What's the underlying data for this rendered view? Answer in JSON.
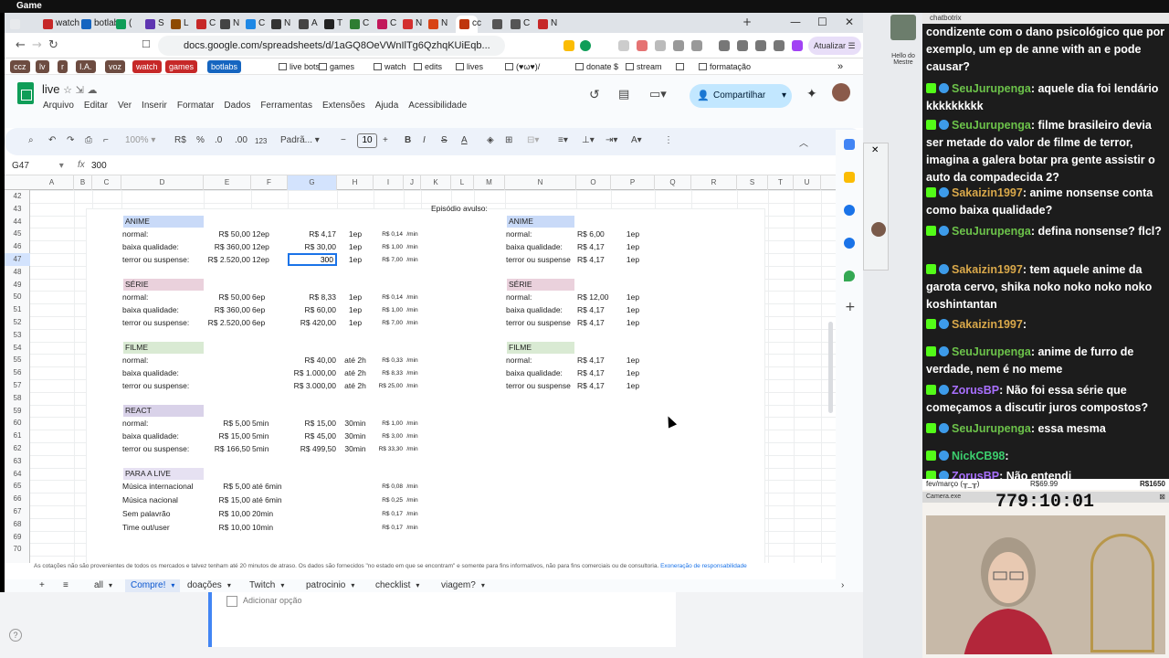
{
  "os": {
    "title": "Game"
  },
  "browser": {
    "tabs": [
      {
        "label": "",
        "color": "#e8eaed"
      },
      {
        "label": "watch",
        "color": "#c62828"
      },
      {
        "label": "botlabs",
        "color": "#1565c0"
      },
      {
        "label": "(",
        "color": "#0f9d58"
      },
      {
        "label": "S",
        "color": "#5e35b1"
      },
      {
        "label": "L",
        "color": "#8e4a00"
      },
      {
        "label": "C",
        "color": "#c62828"
      },
      {
        "label": "N",
        "color": "#444"
      },
      {
        "label": "C",
        "color": "#1e88e5"
      },
      {
        "label": "N",
        "color": "#333"
      },
      {
        "label": "A",
        "color": "#444"
      },
      {
        "label": "T",
        "color": "#222"
      },
      {
        "label": "C",
        "color": "#2e7d32"
      },
      {
        "label": "C",
        "color": "#c2185b"
      },
      {
        "label": "N",
        "color": "#d32f2f"
      },
      {
        "label": "N",
        "color": "#d84315"
      },
      {
        "label": "cc",
        "color": "#bf360c"
      },
      {
        "label": "",
        "color": "#555"
      },
      {
        "label": "C",
        "color": "#555"
      },
      {
        "label": "N",
        "color": "#c62828"
      }
    ],
    "url": "docs.google.com/spreadsheets/d/1aGQ8OeVWnIlTg6QzhqKUiEqb...",
    "update_label": "Atualizar",
    "bookmarks": [
      {
        "label": "ccz",
        "color": "#6d4c41"
      },
      {
        "label": "lv",
        "color": "#6d4c41"
      },
      {
        "label": "r",
        "color": "#6d4c41"
      },
      {
        "label": "I.A.",
        "color": "#6d4c41"
      },
      {
        "label": "voz",
        "color": "#6d4c41"
      },
      {
        "label": "watch",
        "color": "#c62828"
      },
      {
        "label": "games",
        "color": "#c62828"
      },
      {
        "label": "botlabs",
        "color": "#1565c0"
      },
      {
        "label": "live bots",
        "color": ""
      },
      {
        "label": "games",
        "color": ""
      },
      {
        "label": "watch",
        "color": ""
      },
      {
        "label": "edits",
        "color": ""
      },
      {
        "label": "lives",
        "color": ""
      },
      {
        "label": "(♥ω♥)/",
        "color": ""
      },
      {
        "label": "donate $",
        "color": ""
      },
      {
        "label": "stream",
        "color": ""
      },
      {
        "label": "",
        "color": ""
      },
      {
        "label": "formatação",
        "color": ""
      }
    ]
  },
  "sheets": {
    "title": "live",
    "menus": [
      "Arquivo",
      "Editar",
      "Ver",
      "Inserir",
      "Formatar",
      "Dados",
      "Ferramentas",
      "Extensões",
      "Ajuda",
      "Acessibilidade"
    ],
    "share_label": "Compartilhar",
    "toolbar": {
      "zoom": "100%",
      "currency": "R$",
      "percent": "%",
      "dec_less": ".0",
      "dec_more": ".00",
      "num_format": "123",
      "font": "Padrã...",
      "font_size": "10"
    },
    "cell_ref": "G47",
    "formula_value": "300",
    "columns": [
      "A",
      "B",
      "C",
      "D",
      "E",
      "F",
      "G",
      "H",
      "I",
      "J",
      "K",
      "L",
      "M",
      "N",
      "O",
      "P",
      "Q",
      "R",
      "S",
      "T",
      "U"
    ],
    "selected_col": "G",
    "rows": [
      "42",
      "43",
      "44",
      "45",
      "46",
      "47",
      "48",
      "49",
      "50",
      "51",
      "52",
      "53",
      "54",
      "55",
      "56",
      "57",
      "58",
      "59",
      "60",
      "61",
      "62",
      "63",
      "64",
      "65",
      "66",
      "67",
      "68",
      "69",
      "70"
    ],
    "selected_row": "47",
    "episodio_label": "Episódio avulso:",
    "left": {
      "anime": {
        "title": "ANIME",
        "rows": [
          {
            "label": "normal:",
            "e": "R$ 50,00",
            "f": "12ep",
            "g": "R$ 4,17",
            "h": "1ep",
            "i": "R$ 0,14",
            "j": "/min"
          },
          {
            "label": "baixa qualidade:",
            "e": "R$ 360,00",
            "f": "12ep",
            "g": "R$ 30,00",
            "h": "1ep",
            "i": "R$ 1,00",
            "j": "/min"
          },
          {
            "label": "terror ou suspense:",
            "e": "R$ 2.520,00",
            "f": "12ep",
            "g": "300",
            "h": "1ep",
            "i": "R$ 7,00",
            "j": "/min"
          }
        ]
      },
      "serie": {
        "title": "SÉRIE",
        "rows": [
          {
            "label": "normal:",
            "e": "R$ 50,00",
            "f": "6ep",
            "g": "R$ 8,33",
            "h": "1ep",
            "i": "R$ 0,14",
            "j": "/min"
          },
          {
            "label": "baixa qualidade:",
            "e": "R$ 360,00",
            "f": "6ep",
            "g": "R$ 60,00",
            "h": "1ep",
            "i": "R$ 1,00",
            "j": "/min"
          },
          {
            "label": "terror ou suspense:",
            "e": "R$ 2.520,00",
            "f": "6ep",
            "g": "R$ 420,00",
            "h": "1ep",
            "i": "R$ 7,00",
            "j": "/min"
          }
        ]
      },
      "filme": {
        "title": "FILME",
        "rows": [
          {
            "label": "normal:",
            "e": "",
            "f": "",
            "g": "R$ 40,00",
            "h": "até 2h",
            "i": "R$ 0,33",
            "j": "/min"
          },
          {
            "label": "baixa qualidade:",
            "e": "",
            "f": "",
            "g": "R$ 1.000,00",
            "h": "até 2h",
            "i": "R$ 8,33",
            "j": "/min"
          },
          {
            "label": "terror ou suspense:",
            "e": "",
            "f": "",
            "g": "R$ 3.000,00",
            "h": "até 2h",
            "i": "R$ 25,00",
            "j": "/min"
          }
        ]
      },
      "react": {
        "title": "REACT",
        "rows": [
          {
            "label": "normal:",
            "e": "R$ 5,00",
            "f": "5min",
            "g": "R$ 15,00",
            "h": "30min",
            "i": "R$ 1,00",
            "j": "/min"
          },
          {
            "label": "baixa qualidade:",
            "e": "R$ 15,00",
            "f": "5min",
            "g": "R$ 45,00",
            "h": "30min",
            "i": "R$ 3,00",
            "j": "/min"
          },
          {
            "label": "terror ou suspense:",
            "e": "R$ 166,50",
            "f": "5min",
            "g": "R$ 499,50",
            "h": "30min",
            "i": "R$ 33,30",
            "j": "/min"
          }
        ]
      },
      "live": {
        "title": "PARA A LIVE",
        "rows": [
          {
            "label": "Música internacional",
            "e": "R$ 5,00",
            "f": "até 6min",
            "i": "R$ 0,08",
            "j": "/min"
          },
          {
            "label": "Música nacional",
            "e": "R$ 15,00",
            "f": "até 6min",
            "i": "R$ 0,25",
            "j": "/min"
          },
          {
            "label": "Sem palavrão",
            "e": "R$ 10,00",
            "f": "20min",
            "i": "R$ 0,17",
            "j": "/min"
          },
          {
            "label": "Time out/user",
            "e": "R$ 10,00",
            "f": "10min",
            "i": "R$ 0,17",
            "j": "/min"
          }
        ]
      }
    },
    "right": {
      "anime": {
        "title": "ANIME",
        "rows": [
          {
            "label": "normal:",
            "o": "R$ 6,00",
            "p": "1ep"
          },
          {
            "label": "baixa qualidade:",
            "o": "R$ 4,17",
            "p": "1ep"
          },
          {
            "label": "terror ou suspense",
            "o": "R$ 4,17",
            "p": "1ep"
          }
        ]
      },
      "serie": {
        "title": "SÉRIE",
        "rows": [
          {
            "label": "normal:",
            "o": "R$ 12,00",
            "p": "1ep"
          },
          {
            "label": "baixa qualidade:",
            "o": "R$ 4,17",
            "p": "1ep"
          },
          {
            "label": "terror ou suspense",
            "o": "R$ 4,17",
            "p": "1ep"
          }
        ]
      },
      "filme": {
        "title": "FILME",
        "rows": [
          {
            "label": "normal:",
            "o": "R$ 4,17",
            "p": "1ep"
          },
          {
            "label": "baixa qualidade:",
            "o": "R$ 4,17",
            "p": "1ep"
          },
          {
            "label": "terror ou suspense",
            "o": "R$ 4,17",
            "p": "1ep"
          }
        ]
      }
    },
    "section_colors": {
      "anime": "#c9daf8",
      "serie": "#ead1dc",
      "filme": "#d9ead3",
      "react": "#d9d2e9",
      "live": "#e6e1f2"
    },
    "disclaimer": "As cotações não são provenientes de todos os mercados e talvez tenham até 20 minutos de atraso. Os dados são fornecidos \"no estado em que se encontram\" e somente para fins informativos, não para fins comerciais ou de consultoria.",
    "disclaimer_link": "Exoneração de responsabilidade",
    "sheet_tabs": [
      {
        "label": "all",
        "active": false
      },
      {
        "label": "Compre!",
        "active": true
      },
      {
        "label": "doações",
        "active": false
      },
      {
        "label": "Twitch",
        "active": false
      },
      {
        "label": "patrocinio",
        "active": false
      },
      {
        "label": "checklist",
        "active": false
      },
      {
        "label": "viagem?",
        "active": false
      }
    ]
  },
  "behind_form": {
    "add_option": "Adicionar opção"
  },
  "bot_label": "Hello do Mestre",
  "chat": {
    "header": "chatbotrix",
    "messages": [
      {
        "user": "",
        "text": "condizente com o dano psicológico que por exemplo, um ep de anne with an e pode causar?",
        "color": "#fff"
      },
      {
        "user": "SeuJurupenga",
        "text": ": aquele dia foi lendário kkkkkkkkk",
        "color": "#6cc24a"
      },
      {
        "user": "SeuJurupenga",
        "text": ": filme brasileiro devia ser metade do valor de filme de terror, imagina a galera botar pra gente assistir o auto da compadecida 2?",
        "color": "#6cc24a"
      },
      {
        "user": "Sakaizin1997",
        "text": ": anime nonsense conta como baixa qualidade?",
        "color": "#d9a84a"
      },
      {
        "user": "SeuJurupenga",
        "text": ": defina nonsense? flcl?",
        "color": "#6cc24a"
      },
      {
        "user": "Sakaizin1997",
        "text": ": tem aquele anime da garota cervo, shika noko noko noko noko koshintantan",
        "color": "#d9a84a"
      },
      {
        "user": "Sakaizin1997",
        "text": ":",
        "color": "#d9a84a"
      },
      {
        "user": "SeuJurupenga",
        "text": ": anime de furro de verdade, nem é no meme",
        "color": "#6cc24a"
      },
      {
        "user": "ZorusBP",
        "text": ": Não foi essa série que começamos a discutir juros compostos?",
        "color": "#a970ff"
      },
      {
        "user": "SeuJurupenga",
        "text": ": essa mesma",
        "color": "#6cc24a"
      },
      {
        "user": "NickCB98",
        "text": ":",
        "color": "#3ccf6e"
      },
      {
        "user": "ZorusBP",
        "text": ": Não entendi",
        "color": "#a970ff"
      }
    ]
  },
  "overlay": {
    "tracker_left": "fev/março (╥_╥)",
    "tracker_mid": "R$69.99",
    "tracker_right": "R$1650",
    "cam_title": "Camera.exe",
    "timer": "779:10:01"
  }
}
